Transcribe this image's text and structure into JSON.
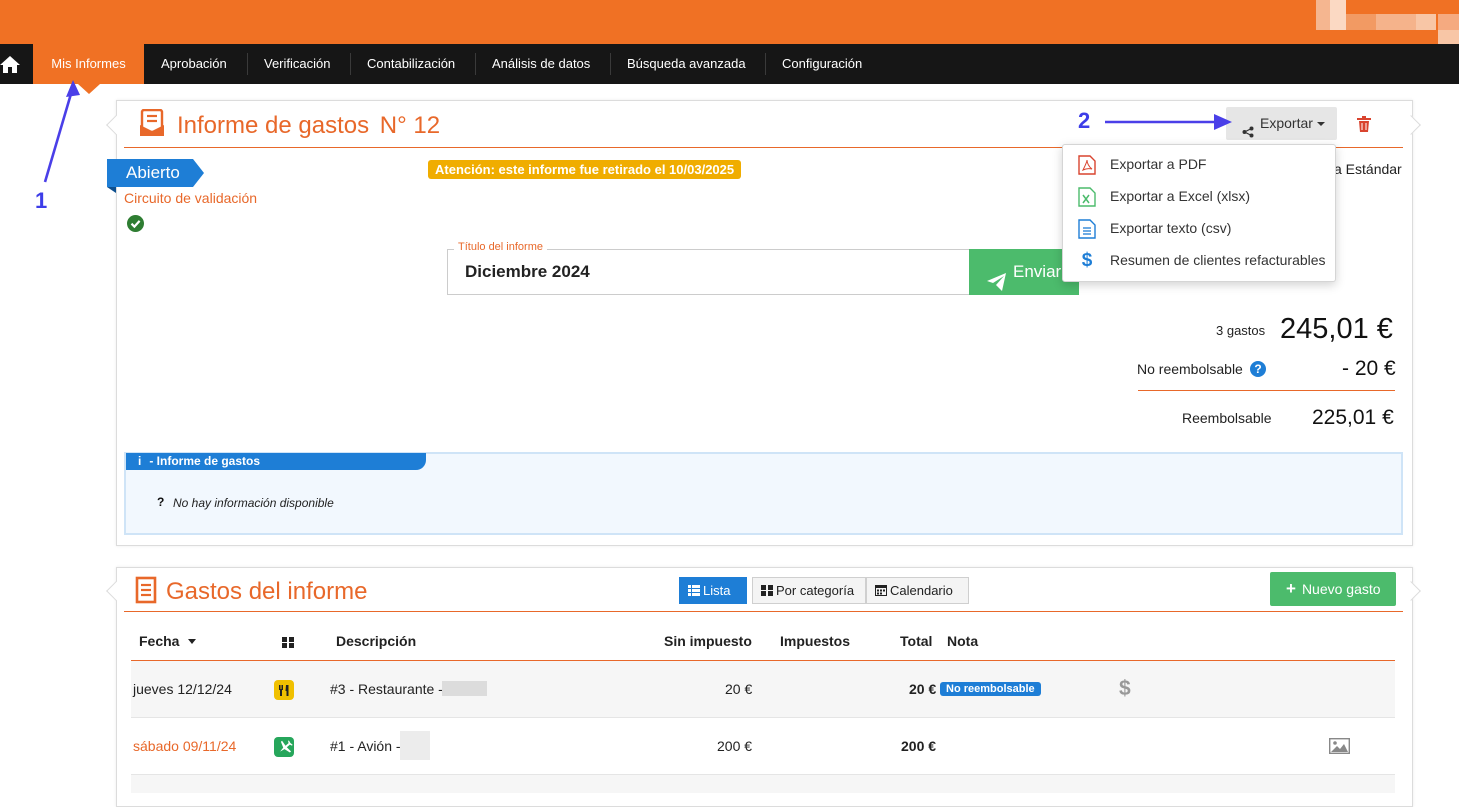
{
  "nav": {
    "items": [
      {
        "label": "Mis Informes",
        "active": true
      },
      {
        "label": "Aprobación"
      },
      {
        "label": "Verificación"
      },
      {
        "label": "Contabilización"
      },
      {
        "label": "Análisis de datos"
      },
      {
        "label": "Búsqueda avanzada"
      },
      {
        "label": "Configuración"
      }
    ]
  },
  "report": {
    "title": "Informe de gastos",
    "number": "N° 12",
    "status": "Abierto",
    "validation_circuit": "Circuito de validación",
    "warning": "Atención: este informe fue retirado el 10/03/2025",
    "type_partial": "a Estándar",
    "title_field_label": "Título del informe",
    "title_field_value": "Diciembre 2024",
    "send_label": "Enviar",
    "export_label": "Exportar",
    "export_menu": [
      {
        "label": "Exportar a PDF",
        "icon": "file-pdf-icon"
      },
      {
        "label": "Exportar a Excel (xlsx)",
        "icon": "file-excel-icon"
      },
      {
        "label": "Exportar texto (csv)",
        "icon": "file-text-icon"
      },
      {
        "label": "Resumen de clientes refacturables",
        "icon": "dollar-icon"
      }
    ]
  },
  "totals": {
    "count_label": "3 gastos",
    "total": "245,01 €",
    "non_refundable_label": "No reembolsable",
    "non_refundable": "- 20 €",
    "refundable_label": "Reembolsable",
    "refundable": "225,01 €"
  },
  "info": {
    "header": "- Informe de gastos",
    "icon_char": "i",
    "empty": "No hay información disponible",
    "empty_mark": "?"
  },
  "expenses": {
    "title": "Gastos del informe",
    "views": [
      "Lista",
      "Por categoría",
      "Calendario"
    ],
    "new_label": "Nuevo gasto",
    "columns": {
      "date": "Fecha",
      "description": "Descripción",
      "net": "Sin impuesto",
      "tax": "Impuestos",
      "total": "Total",
      "note": "Nota"
    },
    "rows": [
      {
        "date": "jueves 12/12/24",
        "category_icon": "restaurant-icon",
        "description": "#3 - Restaurante -",
        "net": "20 €",
        "total": "20 €",
        "badge": "No reembolsable",
        "date_color": "#222222"
      },
      {
        "date": "sábado 09/11/24",
        "category_icon": "plane-icon",
        "description": "#1 - Avión -",
        "net": "200 €",
        "total": "200 €",
        "date_color": "#e8682a"
      }
    ]
  },
  "annotations": {
    "step1": "1",
    "step2": "2"
  },
  "colors": {
    "brand": "#f07124",
    "accent_blue": "#1e7ed6",
    "success": "#4cbb6c",
    "warning": "#f0ad00"
  }
}
